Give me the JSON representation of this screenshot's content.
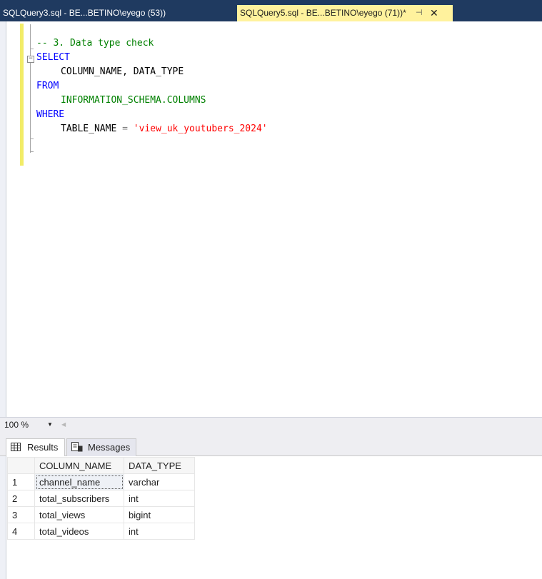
{
  "tabs": [
    {
      "label": "SQLQuery3.sql - BE...BETINO\\eyego (53))",
      "active": false
    },
    {
      "label": "SQLQuery5.sql - BE...BETINO\\eyego (71))*",
      "active": true
    }
  ],
  "tab_icons": {
    "pin": "pin-icon",
    "close": "close-icon"
  },
  "editor": {
    "comment": "-- 3. Data type check",
    "select_kw": "SELECT",
    "columns": "COLUMN_NAME, DATA_TYPE",
    "from_kw": "FROM",
    "source": "INFORMATION_SCHEMA.COLUMNS",
    "where_kw": "WHERE",
    "cond_ident": "TABLE_NAME",
    "cond_op": "=",
    "cond_value": "'view_uk_youtubers_2024'"
  },
  "zoom": {
    "value": "100 %"
  },
  "results_tabs": {
    "results": "Results",
    "messages": "Messages"
  },
  "grid": {
    "headers": [
      "COLUMN_NAME",
      "DATA_TYPE"
    ],
    "rows": [
      {
        "n": "1",
        "column_name": "channel_name",
        "data_type": "varchar"
      },
      {
        "n": "2",
        "column_name": "total_subscribers",
        "data_type": "int"
      },
      {
        "n": "3",
        "column_name": "total_views",
        "data_type": "bigint"
      },
      {
        "n": "4",
        "column_name": "total_videos",
        "data_type": "int"
      }
    ]
  },
  "colors": {
    "tabbar": "#1f3a60",
    "active_tab": "#fff29d",
    "keyword": "#0000ff",
    "comment": "#008000",
    "string": "#ff0000"
  }
}
